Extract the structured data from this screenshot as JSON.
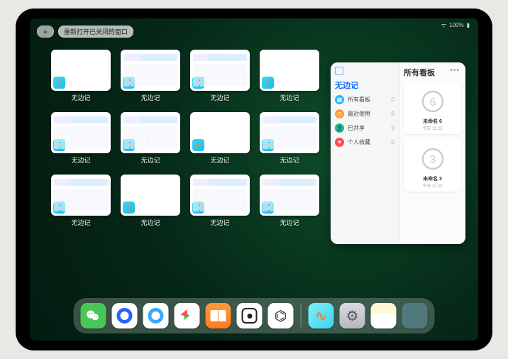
{
  "status": {
    "battery": "100%",
    "time": ""
  },
  "top": {
    "plus": "+",
    "reopen_label": "重新打开已关闭的窗口"
  },
  "app_label": "无边记",
  "windows": [
    {
      "label": "无边记",
      "variant": "plain"
    },
    {
      "label": "无边记",
      "variant": "detailed"
    },
    {
      "label": "无边记",
      "variant": "detailed"
    },
    {
      "label": "无边记",
      "variant": "plain"
    },
    {
      "label": "无边记",
      "variant": "detailed"
    },
    {
      "label": "无边记",
      "variant": "detailed"
    },
    {
      "label": "无边记",
      "variant": "plain"
    },
    {
      "label": "无边记",
      "variant": "detailed"
    },
    {
      "label": "无边记",
      "variant": "detailed"
    },
    {
      "label": "无边记",
      "variant": "plain"
    },
    {
      "label": "无边记",
      "variant": "detailed"
    },
    {
      "label": "无边记",
      "variant": "detailed"
    }
  ],
  "panel": {
    "left_title": "无边记",
    "right_title": "所有看板",
    "ellipsis": "•••",
    "menu": [
      {
        "icon": "grid-icon",
        "color": "ic-blue",
        "label": "所有看板",
        "count": "0"
      },
      {
        "icon": "clock-icon",
        "color": "ic-orange",
        "label": "最近使用",
        "count": "0"
      },
      {
        "icon": "user-icon",
        "color": "ic-green",
        "label": "已共享",
        "count": "0"
      },
      {
        "icon": "heart-icon",
        "color": "ic-red",
        "label": "个人收藏",
        "count": "0"
      }
    ],
    "boards": [
      {
        "name": "未命名 6",
        "date": "今天 11:25",
        "digit": "6"
      },
      {
        "name": "未命名 3",
        "date": "今天 11:25",
        "digit": "3"
      }
    ]
  },
  "dock": [
    {
      "name": "wechat-icon"
    },
    {
      "name": "qqbrowser-icon"
    },
    {
      "name": "quark-icon"
    },
    {
      "name": "play-icon"
    },
    {
      "name": "books-icon"
    },
    {
      "name": "dice-icon"
    },
    {
      "name": "hex-icon"
    },
    {
      "name": "freeform-icon"
    },
    {
      "name": "settings-icon"
    },
    {
      "name": "notes-icon"
    },
    {
      "name": "appgroup-icon"
    }
  ]
}
